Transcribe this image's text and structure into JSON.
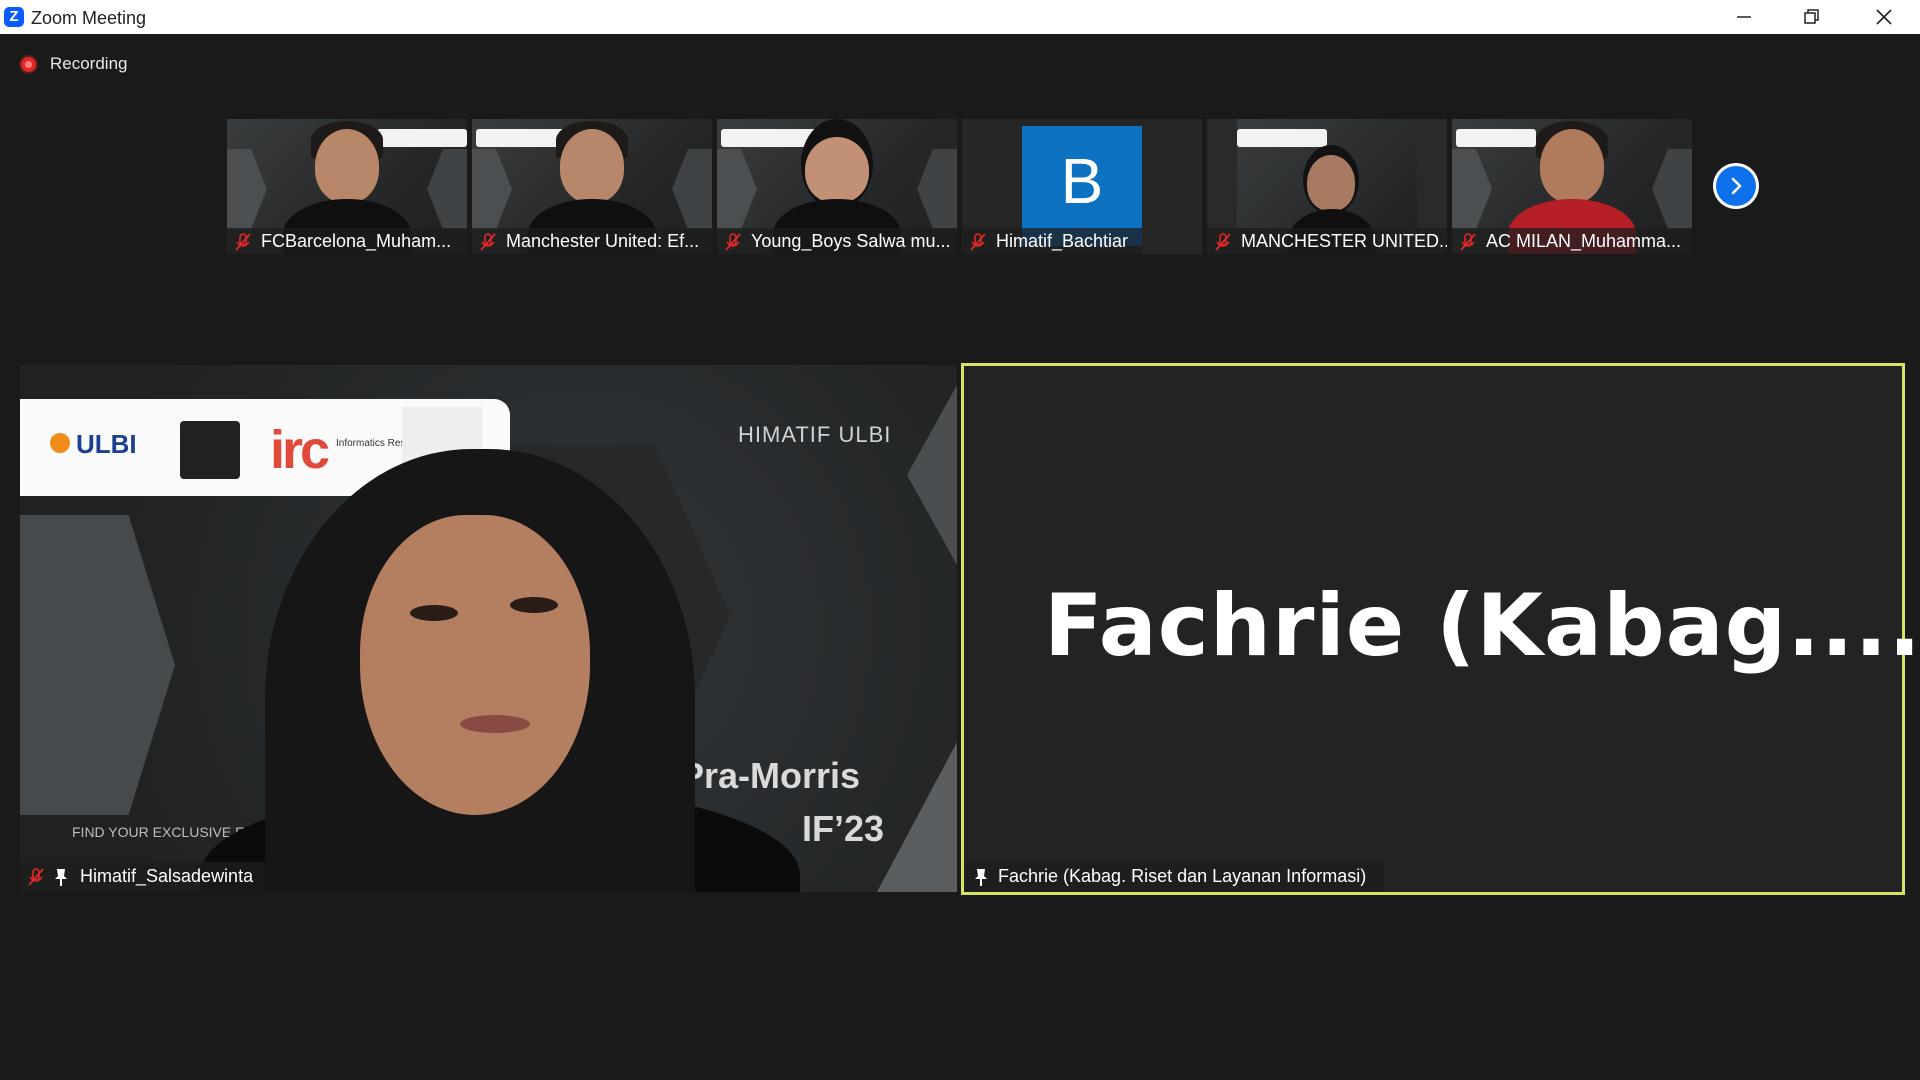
{
  "window": {
    "title": "Zoom Meeting",
    "app_icon": "Z"
  },
  "recording": {
    "label": "Recording"
  },
  "thumbnails": [
    {
      "name": "FCBarcelona_Muham..."
    },
    {
      "name": "Manchester United: Ef..."
    },
    {
      "name": "Young_Boys Salwa mu..."
    },
    {
      "name": "Himatif_Bachtiar",
      "avatar_letter": "B"
    },
    {
      "name": "MANCHESTER UNITED..."
    },
    {
      "name": "AC MILAN_Muhamma..."
    }
  ],
  "main_left": {
    "name": "Himatif_Salsadewinta",
    "background_text": {
      "himatif_ulbi": "HIMATIF ULBI",
      "pra_morris": "Pra-Morris",
      "if23": "IF’23",
      "tagline": "FIND YOUR EXCLUSIVE EXP",
      "logo_ulbi": "ULBI",
      "logo_irc": "irc",
      "logo_irc_text": "Informatics Research Center"
    }
  },
  "main_right": {
    "display_name": "Fachrie  (Kabag....",
    "name": "Fachrie (Kabag. Riset dan Layanan Informasi)",
    "border_color": "#d6e365"
  },
  "colors": {
    "accent": "#0e71eb",
    "recording": "#e02828"
  }
}
